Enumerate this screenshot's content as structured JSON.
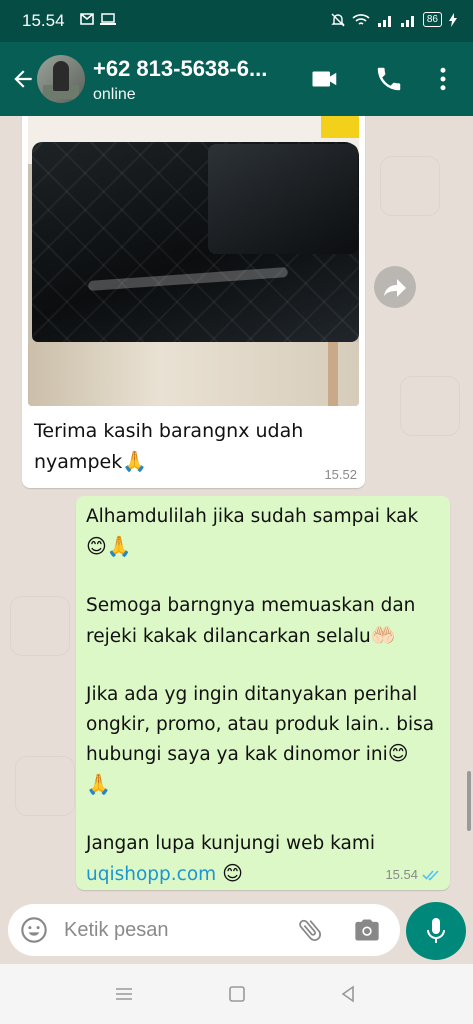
{
  "status_bar": {
    "time": "15.54",
    "battery": "86",
    "icons": [
      "gmail-icon",
      "laptop-icon",
      "mute-icon",
      "wifi-icon",
      "signal-icon",
      "signal-icon",
      "battery-icon",
      "charging-icon"
    ]
  },
  "header": {
    "contact_name": "+62 813-5638-6...",
    "contact_status": "online"
  },
  "messages": [
    {
      "direction": "incoming",
      "type": "image",
      "caption_line1": "Terima kasih barangnx udah",
      "caption_line2": "nyampek",
      "caption_emoji": "🙏",
      "time": "15.52"
    },
    {
      "direction": "outgoing",
      "lines": {
        "p1": "Alhamdulilah jika sudah sampai kak",
        "p1_emoji": "😊🙏",
        "p2": "Semoga barngnya memuaskan dan rejeki kakak dilancarkan selalu",
        "p2_emoji": "🤲🏻",
        "p3": "Jika ada yg ingin ditanyakan perihal ongkir, promo, atau produk lain.. bisa hubungi saya ya kak dinomor ini",
        "p3_emoji": "😊",
        "p3_emoji2": "🙏",
        "p4": "Jangan lupa kunjungi web kami",
        "p4_link": "uqishopp.com",
        "p4_emoji": "😊"
      },
      "time": "15.54",
      "status": "read"
    }
  ],
  "input": {
    "placeholder": "Ketik pesan"
  },
  "colors": {
    "header": "#075e54",
    "status_bar": "#054c44",
    "outgoing_bubble": "#dcf8c6",
    "incoming_bubble": "#ffffff",
    "mic_button": "#00897b",
    "link": "#1b95d3",
    "read_ticks": "#4fc3f7"
  }
}
